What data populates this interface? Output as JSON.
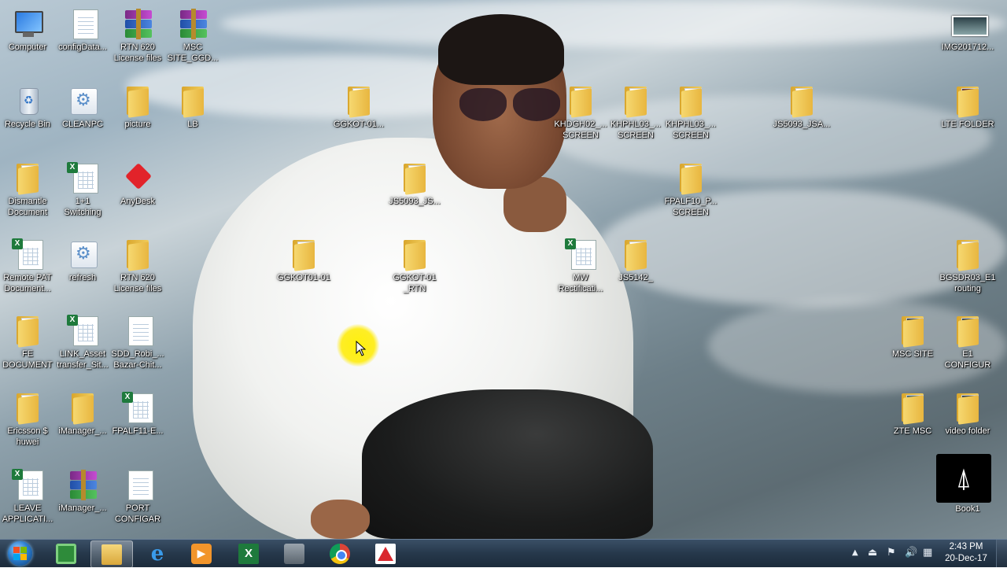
{
  "desktop": {
    "icons": [
      {
        "label": "Computer",
        "type": "computer"
      },
      {
        "label": "configData...",
        "type": "doc"
      },
      {
        "label": "RTN 620\nLicense files",
        "type": "rar"
      },
      {
        "label": "MSC\nSITE_GGD...",
        "type": "rar"
      },
      {
        "label": "Recycle Bin",
        "type": "bin"
      },
      {
        "label": "CLEANPC",
        "type": "gear"
      },
      {
        "label": "picture",
        "type": "folder"
      },
      {
        "label": "LB",
        "type": "folder"
      },
      {
        "label": "Dismantle\nDocument",
        "type": "folder"
      },
      {
        "label": "1+1\nSwitching",
        "type": "xls"
      },
      {
        "label": "AnyDesk",
        "type": "anydesk"
      },
      {
        "label": "Remote PAT\nDocument...",
        "type": "xls"
      },
      {
        "label": "refresh",
        "type": "gear"
      },
      {
        "label": "RTN 620\nLicense files",
        "type": "folder"
      },
      {
        "label": "FE\nDOCUMENT",
        "type": "folder"
      },
      {
        "label": "LINK_Asset\ntransfer_Sit...",
        "type": "xls"
      },
      {
        "label": "SDD_Robi_...\nBazar-Chit...",
        "type": "doc"
      },
      {
        "label": "Ericsson $\nhuwei",
        "type": "folder"
      },
      {
        "label": "iManager_...",
        "type": "folder"
      },
      {
        "label": "FPALF11-E...",
        "type": "xls"
      },
      {
        "label": "LEAVE\nAPPLICATI...",
        "type": "xls"
      },
      {
        "label": "iManager_...",
        "type": "rar"
      },
      {
        "label": "PORT\nCONFIGAR",
        "type": "doc"
      },
      {
        "label": "GGKOT-01...",
        "type": "folder"
      },
      {
        "label": "JS5093_JS...",
        "type": "folder"
      },
      {
        "label": "GGKOT01-01",
        "type": "folder"
      },
      {
        "label": "GGKOT-01\n_RTN",
        "type": "folder"
      },
      {
        "label": "KHDGH02_...\nSCREEN",
        "type": "folder"
      },
      {
        "label": "KHPHL03_...\nSCREEN",
        "type": "folder"
      },
      {
        "label": "KHPHL03_...\nSCREEN",
        "type": "folder"
      },
      {
        "label": "FPALF10_P...\nSCREEN",
        "type": "folder"
      },
      {
        "label": "MW\nRectificati...",
        "type": "xls"
      },
      {
        "label": "JS5142_",
        "type": "folder"
      },
      {
        "label": "JS5093_JSA...",
        "type": "folder"
      },
      {
        "label": "IMG201712...",
        "type": "img"
      },
      {
        "label": "LTE FOLDER",
        "type": "folder"
      },
      {
        "label": "BGSDR03_E1\nrouting",
        "type": "folder"
      },
      {
        "label": "MSC SITE",
        "type": "folder"
      },
      {
        "label": "E1\nCONFIGUR",
        "type": "folder"
      },
      {
        "label": "ZTE MSC",
        "type": "folder"
      },
      {
        "label": "video folder",
        "type": "folder"
      }
    ],
    "book1": {
      "label": "Book1",
      "icon": "autocad-triangle-icon"
    }
  },
  "taskbar": {
    "start_icon": "windows-orb-icon",
    "pinned": [
      {
        "name": "task-manager-icon",
        "active": false
      },
      {
        "name": "file-explorer-icon",
        "active": true
      },
      {
        "name": "internet-explorer-icon",
        "active": false
      },
      {
        "name": "media-player-icon",
        "active": false
      },
      {
        "name": "excel-icon",
        "active": false
      },
      {
        "name": "archive-app-icon",
        "active": false
      },
      {
        "name": "chrome-icon",
        "active": false
      },
      {
        "name": "pdf-reader-icon",
        "active": false
      }
    ],
    "tray": {
      "icons": [
        "show-hidden-icons",
        "usb-device-icon",
        "action-center-flag-icon",
        "volume-icon",
        "network-icon"
      ],
      "time": "2:43 PM",
      "date": "20-Dec-17"
    }
  }
}
